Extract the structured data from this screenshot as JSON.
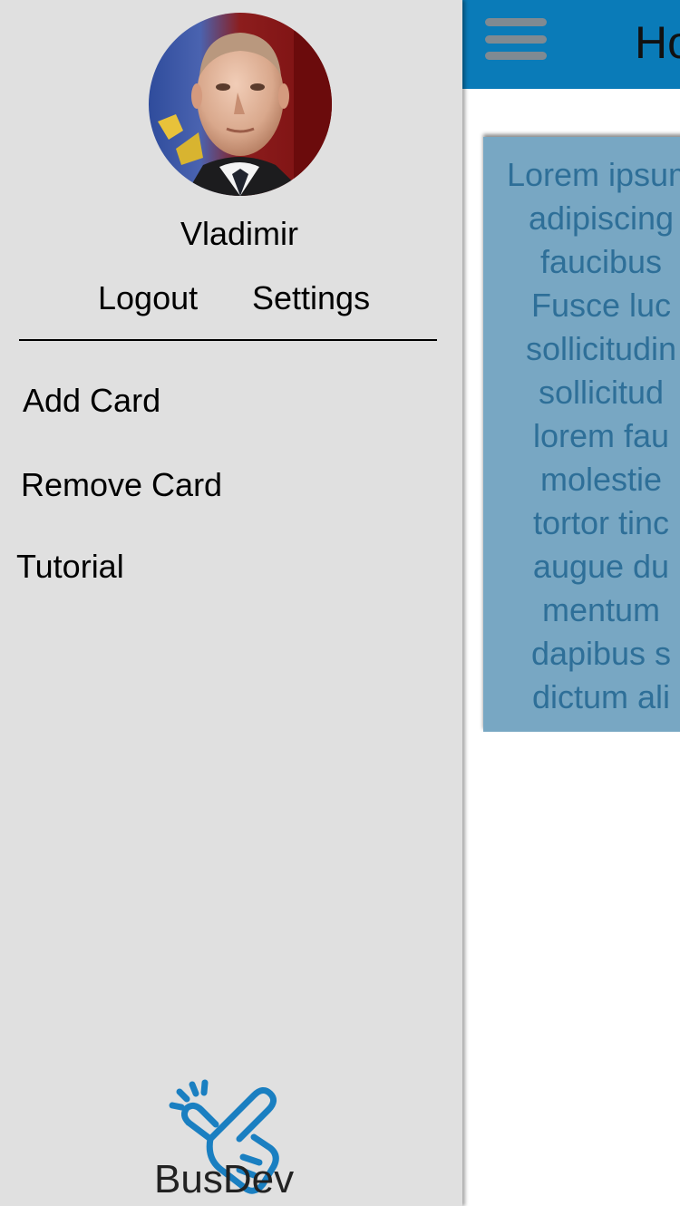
{
  "header": {
    "title": "Home",
    "menu_icon": "hamburger-menu-icon",
    "bar_color": "#0a7bb8"
  },
  "card": {
    "text": "Lorem ipsum\nadipiscing\nfaucibus\nFusce luc\nsollicitudin\nsollicitud\nlorem fau\nmolestie\ntortor tinc\naugue du\nmentum\ndapibus s\ndictum ali",
    "background_color": "#78a7c3",
    "text_color": "#2e6f98"
  },
  "drawer": {
    "background_color": "#e0e0e0",
    "user": {
      "name": "Vladimir"
    },
    "logout_label": "Logout",
    "settings_label": "Settings",
    "menu_items": [
      {
        "label": "Add Card"
      },
      {
        "label": "Remove Card"
      },
      {
        "label": "Tutorial"
      }
    ],
    "logo": {
      "text": "BusDev",
      "icon": "tap-hand-icon",
      "icon_color": "#1a7fc1"
    }
  }
}
